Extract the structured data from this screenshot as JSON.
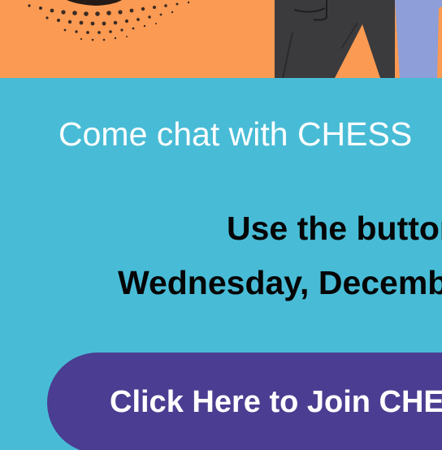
{
  "banner": {
    "illustration_icon": "person-illustration-icon",
    "colors": {
      "background": "#fb9a52",
      "halftone": "#3a2b24",
      "pants": "#3b3b3d",
      "sleeve": "#8d9ed8"
    }
  },
  "main": {
    "headline": "Come chat with CHESS",
    "line_1": "Use the button",
    "line_2": "Wednesday, December",
    "colors": {
      "background": "#48bcd6",
      "headline": "#ffffff",
      "body_text": "#050505"
    }
  },
  "cta": {
    "label": "Click Here to Join CHESS",
    "colors": {
      "background": "#4b3d91",
      "text": "#ffffff"
    }
  }
}
